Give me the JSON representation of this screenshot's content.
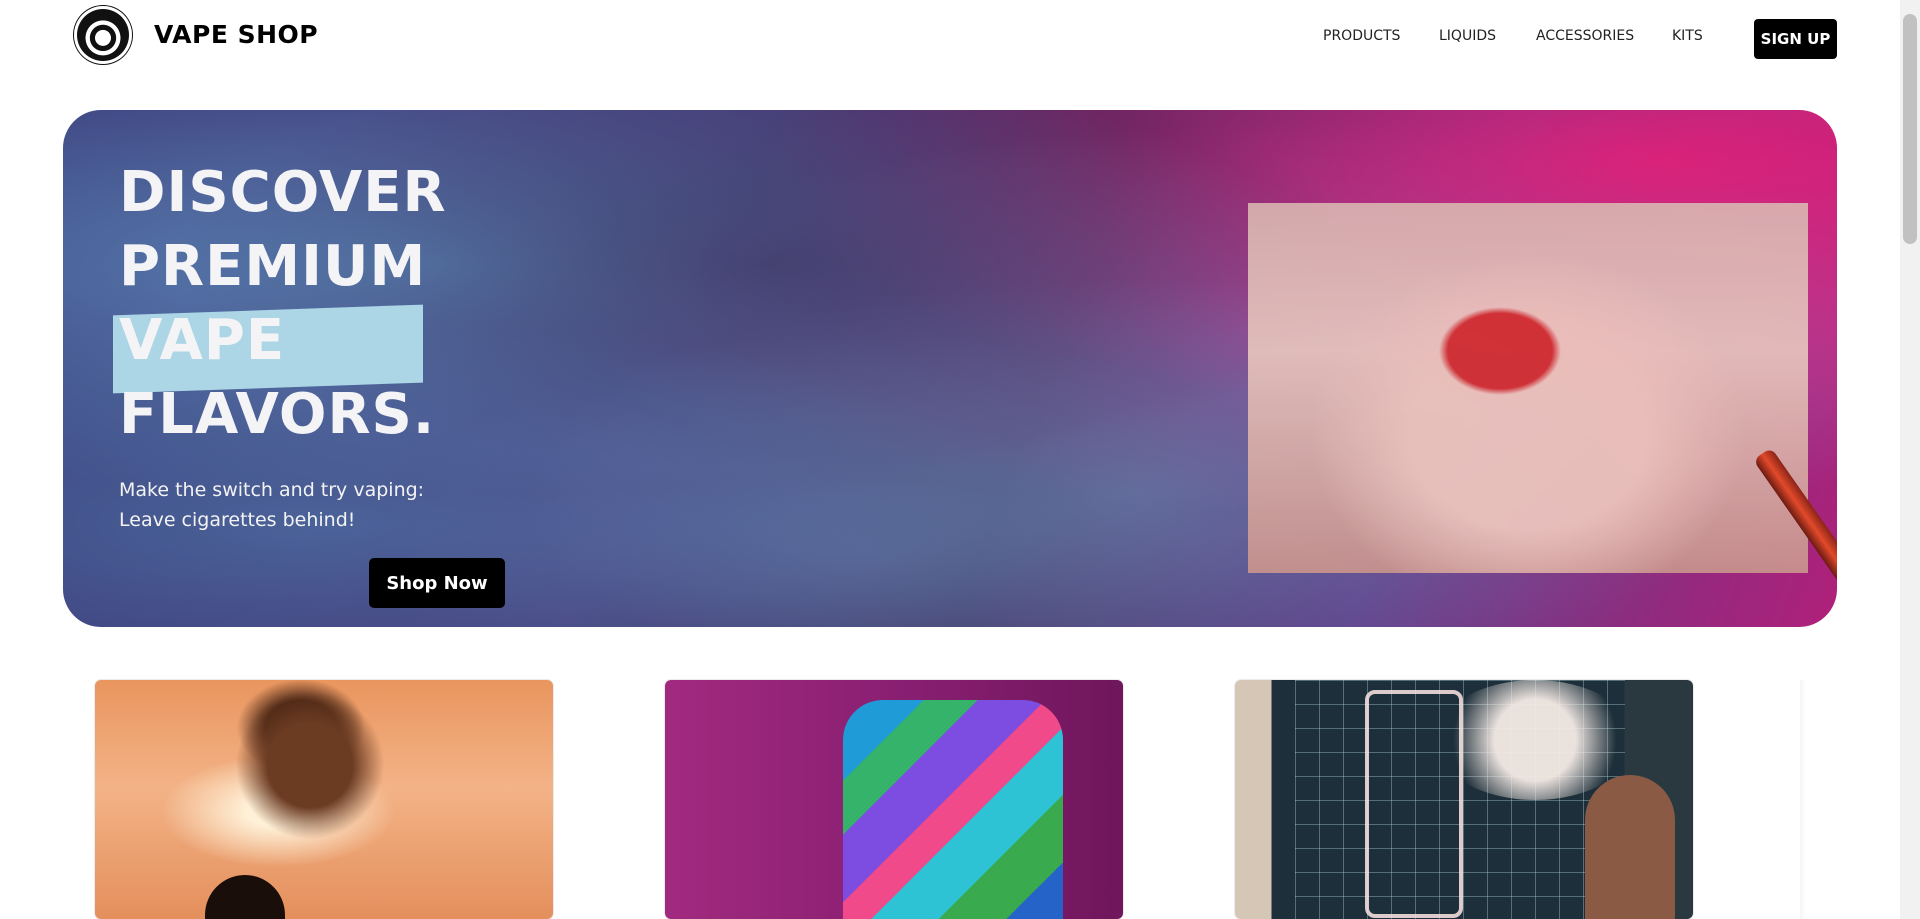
{
  "header": {
    "logo_text": "VAPE SHOP",
    "nav": [
      "PRODUCTS",
      "LIQUIDS",
      "ACCESSORIES",
      "KITS"
    ],
    "signup_label": "SIGN UP"
  },
  "hero": {
    "title_lines": [
      "DISCOVER",
      "PREMIUM",
      "VAPE",
      "FLAVORS."
    ],
    "subtitle_lines": [
      "Make the switch and try vaping:",
      "Leave cigarettes behind!"
    ],
    "cta_label": "Shop Now",
    "highlight_color": "#acd6e6"
  },
  "colors": {
    "button_bg": "#000000",
    "button_text": "#ffffff",
    "accent_pink": "#b0207a",
    "accent_purple": "#473674"
  },
  "cards": [
    {
      "name": "card-sunset-smoke"
    },
    {
      "name": "card-colorful-jacket"
    },
    {
      "name": "card-neon-vaping"
    }
  ]
}
